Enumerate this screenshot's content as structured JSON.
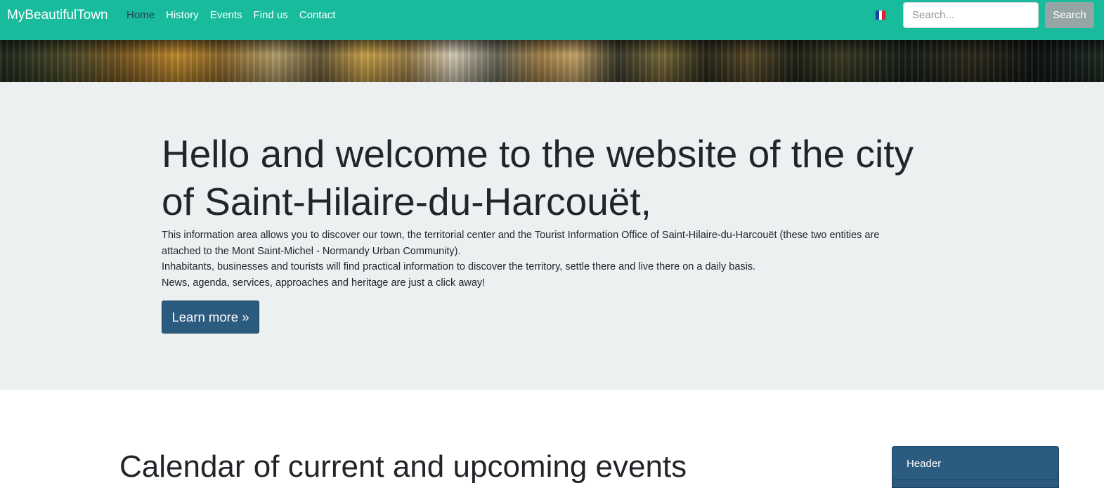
{
  "navbar": {
    "brand": "MyBeautifulTown",
    "links": [
      "Home",
      "History",
      "Events",
      "Find us",
      "Contact"
    ],
    "active_link": "Home",
    "search_placeholder": "Search...",
    "search_button": "Search",
    "language_flag": "flag-fr-icon",
    "colors": {
      "bar": "#18bc9c",
      "active_link": "#2c3e50",
      "search_button": "#95a5a6"
    }
  },
  "jumbotron": {
    "title": "Hello and welcome to the website of the city of Saint-Hilaire-du-Harcouët,",
    "paragraph1": "This information area allows you to discover our town, the territorial center and the Tourist Information Office of Saint-Hilaire-du-Harcouët (these two entities are attached to the Mont Saint-Michel - Normandy Urban Community).",
    "paragraph2": "Inhabitants, businesses and tourists will find practical information to discover the territory, settle there and live there on a daily basis.",
    "paragraph3": "News, agenda, services, approaches and heritage are just a click away!",
    "button": "Learn more »",
    "colors": {
      "background": "#ecf0f1",
      "button": "#2c5b80"
    }
  },
  "calendar": {
    "title": "Calendar of current and upcoming events"
  },
  "sidebar_card": {
    "header": "Header"
  }
}
